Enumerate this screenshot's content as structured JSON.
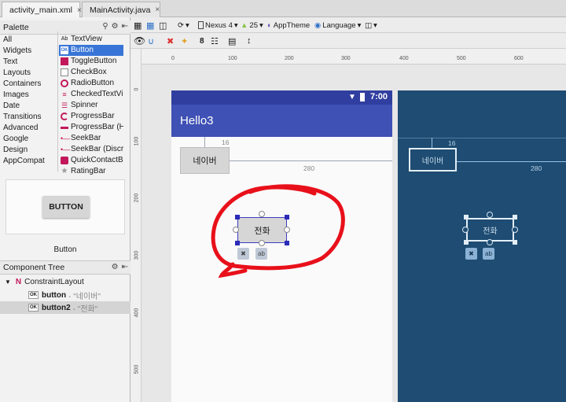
{
  "tabs": [
    {
      "label": "activity_main.xml",
      "close": "×",
      "icon": "layout-file-icon",
      "color": "#d7a32a"
    },
    {
      "label": "MainActivity.java",
      "close": "×",
      "icon": "class-file-icon",
      "color": "#3a7dd8"
    }
  ],
  "palette": {
    "title": "Palette",
    "categories": [
      "All",
      "Widgets",
      "Text",
      "Layouts",
      "Containers",
      "Images",
      "Date",
      "Transitions",
      "Advanced",
      "Google",
      "Design",
      "AppCompat"
    ],
    "items": [
      {
        "label": "TextView",
        "icon": "Ab"
      },
      {
        "label": "Button",
        "icon": "OK",
        "selected": true
      },
      {
        "label": "ToggleButton",
        "icon": "toggle"
      },
      {
        "label": "CheckBox",
        "icon": "check"
      },
      {
        "label": "RadioButton",
        "icon": "radio"
      },
      {
        "label": "CheckedTextView",
        "icon": "list"
      },
      {
        "label": "Spinner",
        "icon": "spinner"
      },
      {
        "label": "ProgressBar",
        "icon": "progress"
      },
      {
        "label": "ProgressBar (Horizontal)",
        "icon": "hprogress"
      },
      {
        "label": "SeekBar",
        "icon": "seek"
      },
      {
        "label": "SeekBar (Discrete)",
        "icon": "seek"
      },
      {
        "label": "QuickContactBadge",
        "icon": "badge"
      },
      {
        "label": "RatingBar",
        "icon": "star"
      }
    ],
    "preview_button": "BUTTON",
    "preview_label": "Button"
  },
  "component_tree": {
    "title": "Component Tree",
    "root": "ConstraintLayout",
    "children": [
      {
        "id": "button",
        "text": "- \"네이버\"",
        "selected": false
      },
      {
        "id": "button2",
        "text": "- \"전화\"",
        "selected": true
      }
    ]
  },
  "toolbar": {
    "device": "Nexus 4",
    "api": "25",
    "theme": "AppTheme",
    "language": "Language"
  },
  "rulers": {
    "h": [
      "0",
      "100",
      "200",
      "300",
      "400",
      "500",
      "600"
    ],
    "v": [
      "0",
      "100",
      "200",
      "300",
      "400",
      "500"
    ]
  },
  "device": {
    "time": "7:00",
    "app_title": "Hello3",
    "button1_text": "네이버",
    "button2_text": "전화",
    "margin_top": "16",
    "margin_start": "280"
  },
  "colors": {
    "status_bar": "#303f9f",
    "app_bar": "#3f51b5",
    "blueprint": "#1e4c72",
    "annotation": "#e8101a"
  }
}
